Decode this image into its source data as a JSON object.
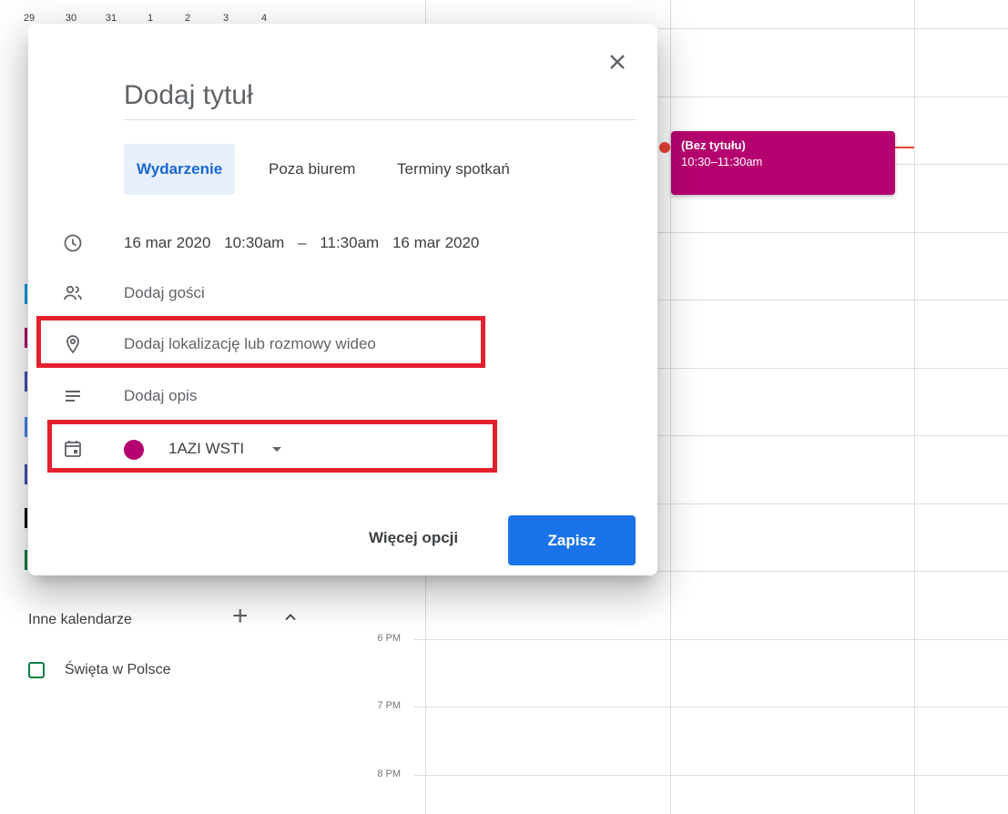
{
  "mini_calendar": {
    "days": [
      "29",
      "30",
      "31",
      "1",
      "2",
      "3",
      "4"
    ]
  },
  "grid": {
    "time_labels": [
      "6 PM",
      "7 PM",
      "8 PM"
    ]
  },
  "event": {
    "title": "(Bez tytułu)",
    "time": "10:30–11:30am",
    "color": "#b5006f"
  },
  "other_calendars": {
    "heading": "Inne kalendarze",
    "items": [
      {
        "label": "Święta w Polsce",
        "color": "#0b8043"
      }
    ]
  },
  "dialog": {
    "title_placeholder": "Dodaj tytuł",
    "tabs": [
      {
        "label": "Wydarzenie",
        "active": true
      },
      {
        "label": "Poza biurem"
      },
      {
        "label": "Terminy spotkań"
      }
    ],
    "datetime": {
      "start_date": "16 mar 2020",
      "start_time": "10:30am",
      "separator": "–",
      "end_time": "11:30am",
      "end_date": "16 mar 2020"
    },
    "guests_label": "Dodaj gości",
    "location_label": "Dodaj lokalizację lub rozmowy wideo",
    "description_label": "Dodaj opis",
    "calendar": {
      "name": "1AZI WSTI",
      "color": "#b5006f"
    },
    "more_options_label": "Więcej opcji",
    "save_label": "Zapisz"
  },
  "colors": {
    "accent": "#1a73e8",
    "highlight": "#e3202d"
  }
}
